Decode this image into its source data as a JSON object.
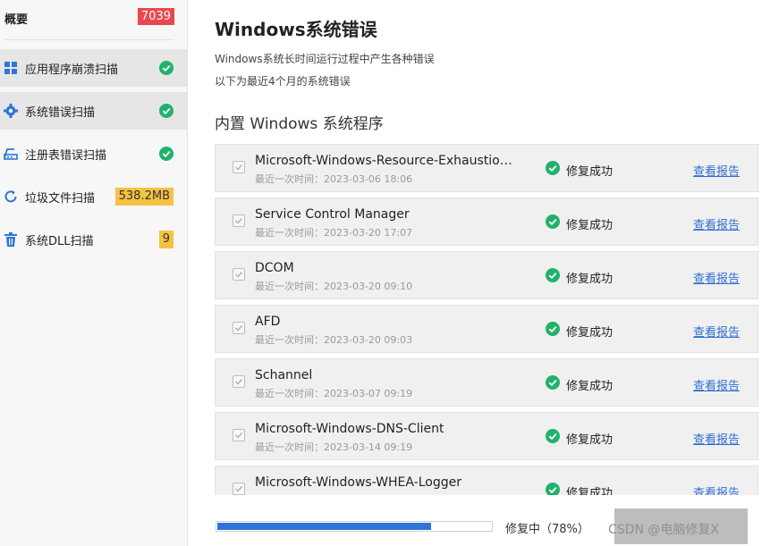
{
  "sidebar": {
    "overview": {
      "label": "概要",
      "count": "7039",
      "count_color": "#e8484f"
    },
    "items": [
      {
        "label": "应用程序崩溃扫描",
        "icon": "grid-apps-icon",
        "state": "done",
        "active": true
      },
      {
        "label": "系统错误扫描",
        "icon": "gear-icon",
        "state": "done",
        "active": true
      },
      {
        "label": "注册表错误扫描",
        "icon": "registry-icon",
        "state": "done",
        "active": false
      },
      {
        "label": "垃圾文件扫描",
        "icon": "refresh-icon",
        "badge": "538.2MB",
        "active": false
      },
      {
        "label": "系统DLL扫描",
        "icon": "trash-icon",
        "badge": "9",
        "active": false
      }
    ]
  },
  "main": {
    "title": "Windows系统错误",
    "description_line1": "Windows系统长时间运行过程中产生各种错误",
    "description_line2": "以下为最近4个月的系统错误",
    "section_title": "内置 Windows 系统程序",
    "rows": [
      {
        "name": "Microsoft-Windows-Resource-Exhaustion...",
        "time": "最近一次时间：2023-03-06 18:06",
        "status": "修复成功",
        "link": "查看报告"
      },
      {
        "name": "Service Control Manager",
        "time": "最近一次时间：2023-03-20 17:07",
        "status": "修复成功",
        "link": "查看报告"
      },
      {
        "name": "DCOM",
        "time": "最近一次时间：2023-03-20 09:10",
        "status": "修复成功",
        "link": "查看报告"
      },
      {
        "name": "AFD",
        "time": "最近一次时间：2023-03-20 09:03",
        "status": "修复成功",
        "link": "查看报告"
      },
      {
        "name": "Schannel",
        "time": "最近一次时间：2023-03-07 09:19",
        "status": "修复成功",
        "link": "查看报告"
      },
      {
        "name": "Microsoft-Windows-DNS-Client",
        "time": "最近一次时间：2023-03-14 09:19",
        "status": "修复成功",
        "link": "查看报告"
      },
      {
        "name": "Microsoft-Windows-WHEA-Logger",
        "time": "",
        "status": "修复成功",
        "link": "查看报告"
      }
    ]
  },
  "footer": {
    "progress_percent": 78,
    "progress_label": "修复中（78%）",
    "watermark": "CSDN @电脑修复X"
  },
  "colors": {
    "accent": "#2f74d8",
    "success": "#20b26b",
    "link": "#2f6fd0",
    "badge_red": "#e8484f",
    "badge_yellow": "#f5c244"
  }
}
